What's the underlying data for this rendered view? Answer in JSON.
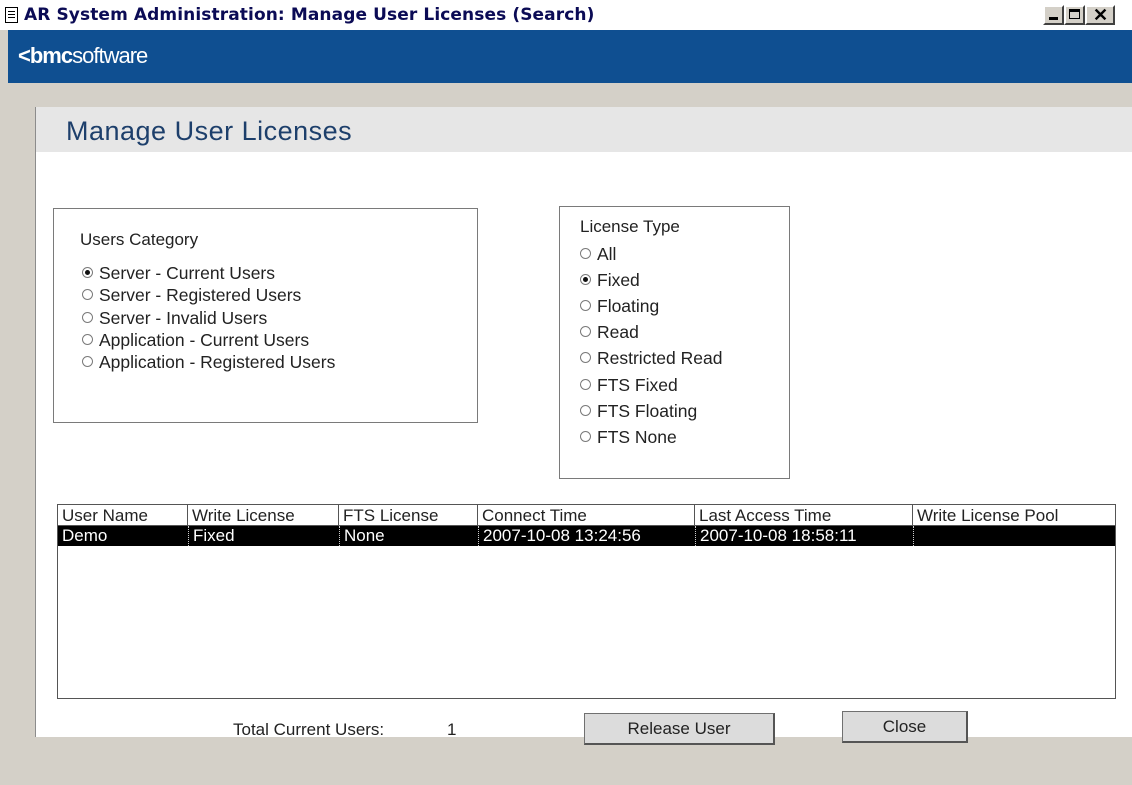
{
  "window": {
    "title": "AR System Administration: Manage User Licenses (Search)",
    "controls": {
      "minimize": "minimize-icon",
      "maximize": "maximize-icon",
      "close": "close-icon"
    }
  },
  "brand": {
    "chevron": "<",
    "bmc": "bmc",
    "software": "software"
  },
  "page": {
    "title": "Manage User Licenses"
  },
  "users_category": {
    "label": "Users Category",
    "options": [
      {
        "label": "Server - Current Users",
        "checked": true
      },
      {
        "label": "Server - Registered Users",
        "checked": false
      },
      {
        "label": "Server - Invalid Users",
        "checked": false
      },
      {
        "label": "Application - Current Users",
        "checked": false
      },
      {
        "label": "Application - Registered Users",
        "checked": false
      }
    ]
  },
  "license_type": {
    "label": "License Type",
    "options": [
      {
        "label": "All",
        "checked": false
      },
      {
        "label": "Fixed",
        "checked": true
      },
      {
        "label": "Floating",
        "checked": false
      },
      {
        "label": "Read",
        "checked": false
      },
      {
        "label": "Restricted Read",
        "checked": false
      },
      {
        "label": "FTS Fixed",
        "checked": false
      },
      {
        "label": "FTS Floating",
        "checked": false
      },
      {
        "label": "FTS None",
        "checked": false
      }
    ]
  },
  "table": {
    "columns": [
      "User Name",
      "Write License",
      "FTS License",
      "Connect Time",
      "Last Access Time",
      "Write License Pool"
    ],
    "rows": [
      [
        "Demo",
        "Fixed",
        "None",
        "2007-10-08 13:24:56",
        "2007-10-08 18:58:11",
        ""
      ]
    ]
  },
  "footer": {
    "total_label": "Total Current Users:",
    "total_value": "1",
    "release_button": "Release User",
    "close_button": "Close"
  }
}
